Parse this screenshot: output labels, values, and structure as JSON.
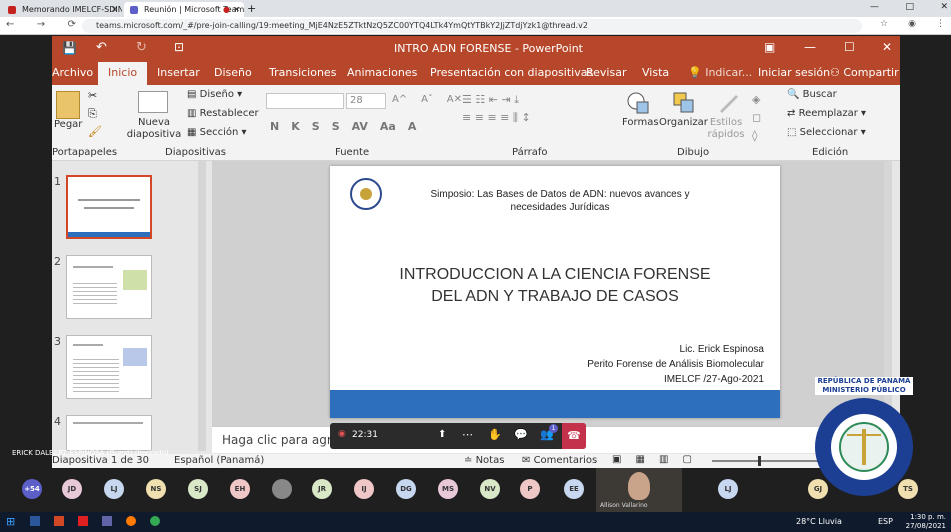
{
  "browser": {
    "tabs": [
      {
        "label": "Memorando IMELCF-SDIN-793-",
        "color": "#c5221f"
      },
      {
        "label": "Reunión | Microsoft Teams",
        "color": "#5b5fc7"
      },
      {
        "label": "",
        "color": "#c5221f"
      }
    ],
    "url": "teams.microsoft.com/_#/pre-join-calling/19:meeting_MjE4NzE5ZTktNzQ5ZC00YTQ4LTk4YmQtYTBkY2JjZTdjYzk1@thread.v2"
  },
  "ppt": {
    "title": "INTRO ADN FORENSE - PowerPoint",
    "menus": [
      "Archivo",
      "Inicio",
      "Insertar",
      "Diseño",
      "Transiciones",
      "Animaciones",
      "Presentación con diapositivas",
      "Revisar",
      "Vista",
      "Indicar...",
      "Iniciar sesión",
      "Compartir"
    ],
    "ribbon": {
      "groups": [
        "Portapapeles",
        "Diapositivas",
        "Fuente",
        "Párrafo",
        "Dibujo",
        "Edición"
      ],
      "paste": "Pegar",
      "new_slide": "Nueva diapositiva",
      "layout": "Diseño",
      "reset": "Restablecer",
      "section": "Sección",
      "font_size": "28",
      "shapes": "Formas",
      "arrange": "Organizar",
      "quick_styles": "Estilos rápidos",
      "find": "Buscar",
      "replace": "Reemplazar",
      "select": "Seleccionar",
      "font_buttons": [
        "N",
        "K",
        "S",
        "S",
        "AV"
      ]
    },
    "thumbs": [
      "1",
      "2",
      "3",
      "4"
    ],
    "slide": {
      "header": "Simposio: Las Bases de Datos de ADN: nuevos avances y necesidades Jurídicas",
      "title_l1": "INTRODUCCION A LA CIENCIA FORENSE",
      "title_l2": "DEL ADN Y TRABAJO DE CASOS",
      "author1": "Lic. Erick Espinosa",
      "author2": "Perito Forense de Análisis Biomolecular",
      "author3": "IMELCF /27-Ago-2021"
    },
    "notes_placeholder": "Haga clic para agregar notas",
    "status": {
      "slide": "Diapositiva 1 de 30",
      "lang": "Español (Panamá)",
      "notes": "Notas",
      "comments": "Comentarios"
    }
  },
  "meeting": {
    "timer": "22:31",
    "presenter": "ERICK DALBERT ESPINOSA (Guest) (Invitado)",
    "badge": "1"
  },
  "logo": {
    "line1": "REPÚBLICA DE PANAMÁ",
    "line2": "MINISTERIO PÚBLICO",
    "ring": "INSTITUTO DE MEDICINA LEGAL Y CIENCIAS FORENSES"
  },
  "participants": [
    {
      "i": "+54",
      "c": "#5b5fc7"
    },
    {
      "i": "JD",
      "c": "#e8c7d9"
    },
    {
      "i": "LJ",
      "c": "#c7d7f0"
    },
    {
      "i": "NS",
      "c": "#f0e0b0"
    },
    {
      "i": "SJ",
      "c": "#d9e8c7"
    },
    {
      "i": "EH",
      "c": "#f0c7c7"
    },
    {
      "i": "",
      "c": "#888"
    },
    {
      "i": "JR",
      "c": "#d9e8c7"
    },
    {
      "i": "IJ",
      "c": "#f0c7c7"
    },
    {
      "i": "DG",
      "c": "#c7d7f0"
    },
    {
      "i": "MS",
      "c": "#e8c7d9"
    },
    {
      "i": "NV",
      "c": "#d9e8c7"
    },
    {
      "i": "P",
      "c": "#f0c7c7"
    },
    {
      "i": "EE",
      "c": "#c7d7f0"
    },
    {
      "i": "LJ",
      "c": "#c7d7f0"
    },
    {
      "i": "GJ",
      "c": "#f0e0b0"
    },
    {
      "i": "TS",
      "c": "#f0e0b0"
    }
  ],
  "video_name": "Allison Vallarino",
  "taskbar": {
    "weather": "28°C Lluvia",
    "lang": "ESP",
    "time": "1:30 p. m.",
    "date": "27/08/2021"
  }
}
